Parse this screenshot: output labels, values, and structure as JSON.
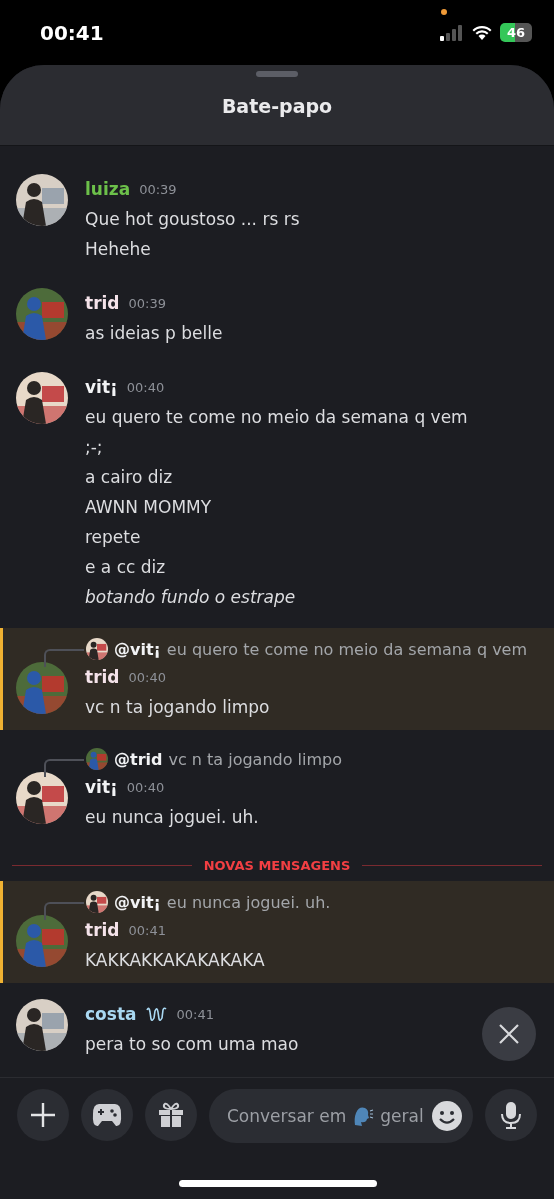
{
  "status_bar": {
    "time": "00:41",
    "battery": "46"
  },
  "header": {
    "title": "Bate-papo"
  },
  "messages": [
    {
      "author": "luiza",
      "color": "#6cc04a",
      "time": "00:39",
      "highlighted": false,
      "badge": false,
      "lines": [
        {
          "kind": "plain",
          "text": "Que hot goustoso ... rs rs"
        },
        {
          "kind": "plain",
          "text": "Hehehe"
        }
      ]
    },
    {
      "author": "trid",
      "color": "#f5e3ea",
      "time": "00:39",
      "highlighted": false,
      "badge": false,
      "lines": [
        {
          "kind": "plain",
          "text": "as ideias p belle"
        }
      ]
    },
    {
      "author": "vit¡",
      "color": "#f2f3f5",
      "time": "00:40",
      "highlighted": false,
      "badge": false,
      "lines": [
        {
          "kind": "plain",
          "text": "eu quero te come no meio da semana q vem"
        },
        {
          "kind": "plain",
          "text": ";-;"
        },
        {
          "kind": "plain",
          "text": "a cairo diz"
        },
        {
          "kind": "plain",
          "text": "AWNN MOMMY"
        },
        {
          "kind": "plain",
          "text": "repete"
        },
        {
          "kind": "plain",
          "text": "e a cc diz"
        },
        {
          "kind": "italic",
          "text": "botando fundo o estrape"
        }
      ]
    },
    {
      "author": "trid",
      "color": "#f5e3ea",
      "time": "00:40",
      "highlighted": true,
      "badge": false,
      "reply": {
        "author": "@vit¡",
        "text": "eu quero te come no meio da semana q vem"
      },
      "lines": [
        {
          "kind": "plain",
          "text": "vc n ta jogando limpo"
        }
      ]
    },
    {
      "author": "vit¡",
      "color": "#f2f3f5",
      "time": "00:40",
      "highlighted": false,
      "badge": false,
      "reply": {
        "author": "@trid",
        "text": "vc n ta jogando limpo"
      },
      "lines": [
        {
          "kind": "plain",
          "text": "eu nunca joguei. uh."
        }
      ]
    },
    {
      "kind": "divider",
      "text": "NOVAS MENSAGENS"
    },
    {
      "author": "trid",
      "color": "#f5e3ea",
      "time": "00:41",
      "highlighted": true,
      "badge": false,
      "reply": {
        "author": "@vit¡",
        "text": "eu nunca joguei. uh."
      },
      "lines": [
        {
          "kind": "plain",
          "text": "KAKKAKKAKAKAKAKA"
        }
      ]
    },
    {
      "author": "costa",
      "color": "#a9d8f2",
      "time": "00:41",
      "highlighted": false,
      "badge": true,
      "lines": [
        {
          "kind": "plain",
          "text": "pera to so com uma mao"
        }
      ]
    }
  ],
  "composer": {
    "placeholder": "Conversar em",
    "channel": "geral"
  }
}
